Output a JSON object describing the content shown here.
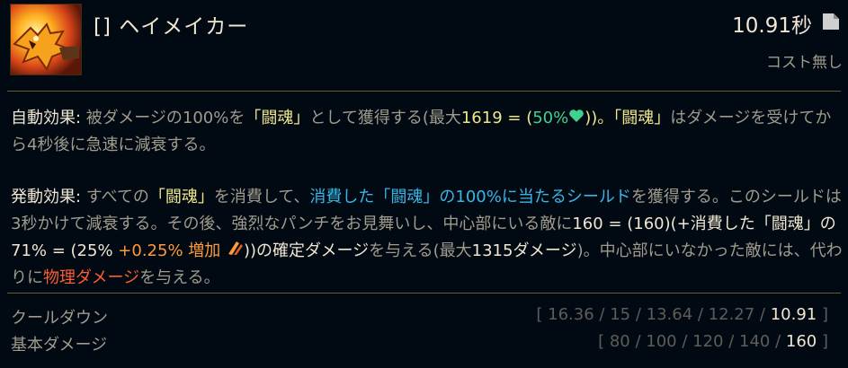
{
  "header": {
    "ability_name": "[] ヘイメイカー",
    "cooldown": "10.91秒",
    "cost": "コスト無し",
    "icon": "fiery-dragon-fist-icon",
    "cooldown_icon": "page-corner-icon"
  },
  "passive": {
    "label": "自動効果",
    "colon": ":",
    "t1": " 被ダメージの100%を",
    "grit1": "「闘魂」",
    "t2": "として獲得する(最大",
    "max_value": "1619 = ",
    "paren_open": "(",
    "pct": "50%",
    "paren_close": "))。",
    "grit2": "「闘魂」",
    "t3": "はダメージを受けてから4秒後に急速に減衰する。"
  },
  "active": {
    "label": "発動効果",
    "colon": ":",
    "t1": " すべての",
    "grit1": "「闘魂」",
    "t2": "を消費して、",
    "shield": "消費した「闘魂」の100%に当たるシールド",
    "t3": "を獲得する。このシールドは3秒かけて減衰する。その後、強烈なパンチをお見舞いし、中心部にいる敵に",
    "dmg1": "160 = (160)(+消費した「闘魂」の71% = (25% ",
    "scale": "+0.25% 増加 ",
    "dmg2": "))の確定ダメージ",
    "t4": "を与える(最大",
    "max": "1315ダメージ",
    "t5": ")。中心部にいなかった敵には、代わりに",
    "physical": "物理ダメージ",
    "t6": "を与える。"
  },
  "stats": [
    {
      "name": "クールダウン",
      "values": [
        "16.36",
        "15",
        "13.64",
        "12.27",
        "10.91"
      ]
    },
    {
      "name": "基本ダメージ",
      "values": [
        "80",
        "100",
        "120",
        "140",
        "160"
      ]
    }
  ],
  "colors": {
    "background": "#010a13",
    "divider": "#6a5a33",
    "grit_gold": "#f0e68c",
    "heal_green": "#3fd28e",
    "shield_blue": "#38b6e6",
    "scaling_orange": "#ff9a3c",
    "physical_red": "#ff5c30"
  }
}
